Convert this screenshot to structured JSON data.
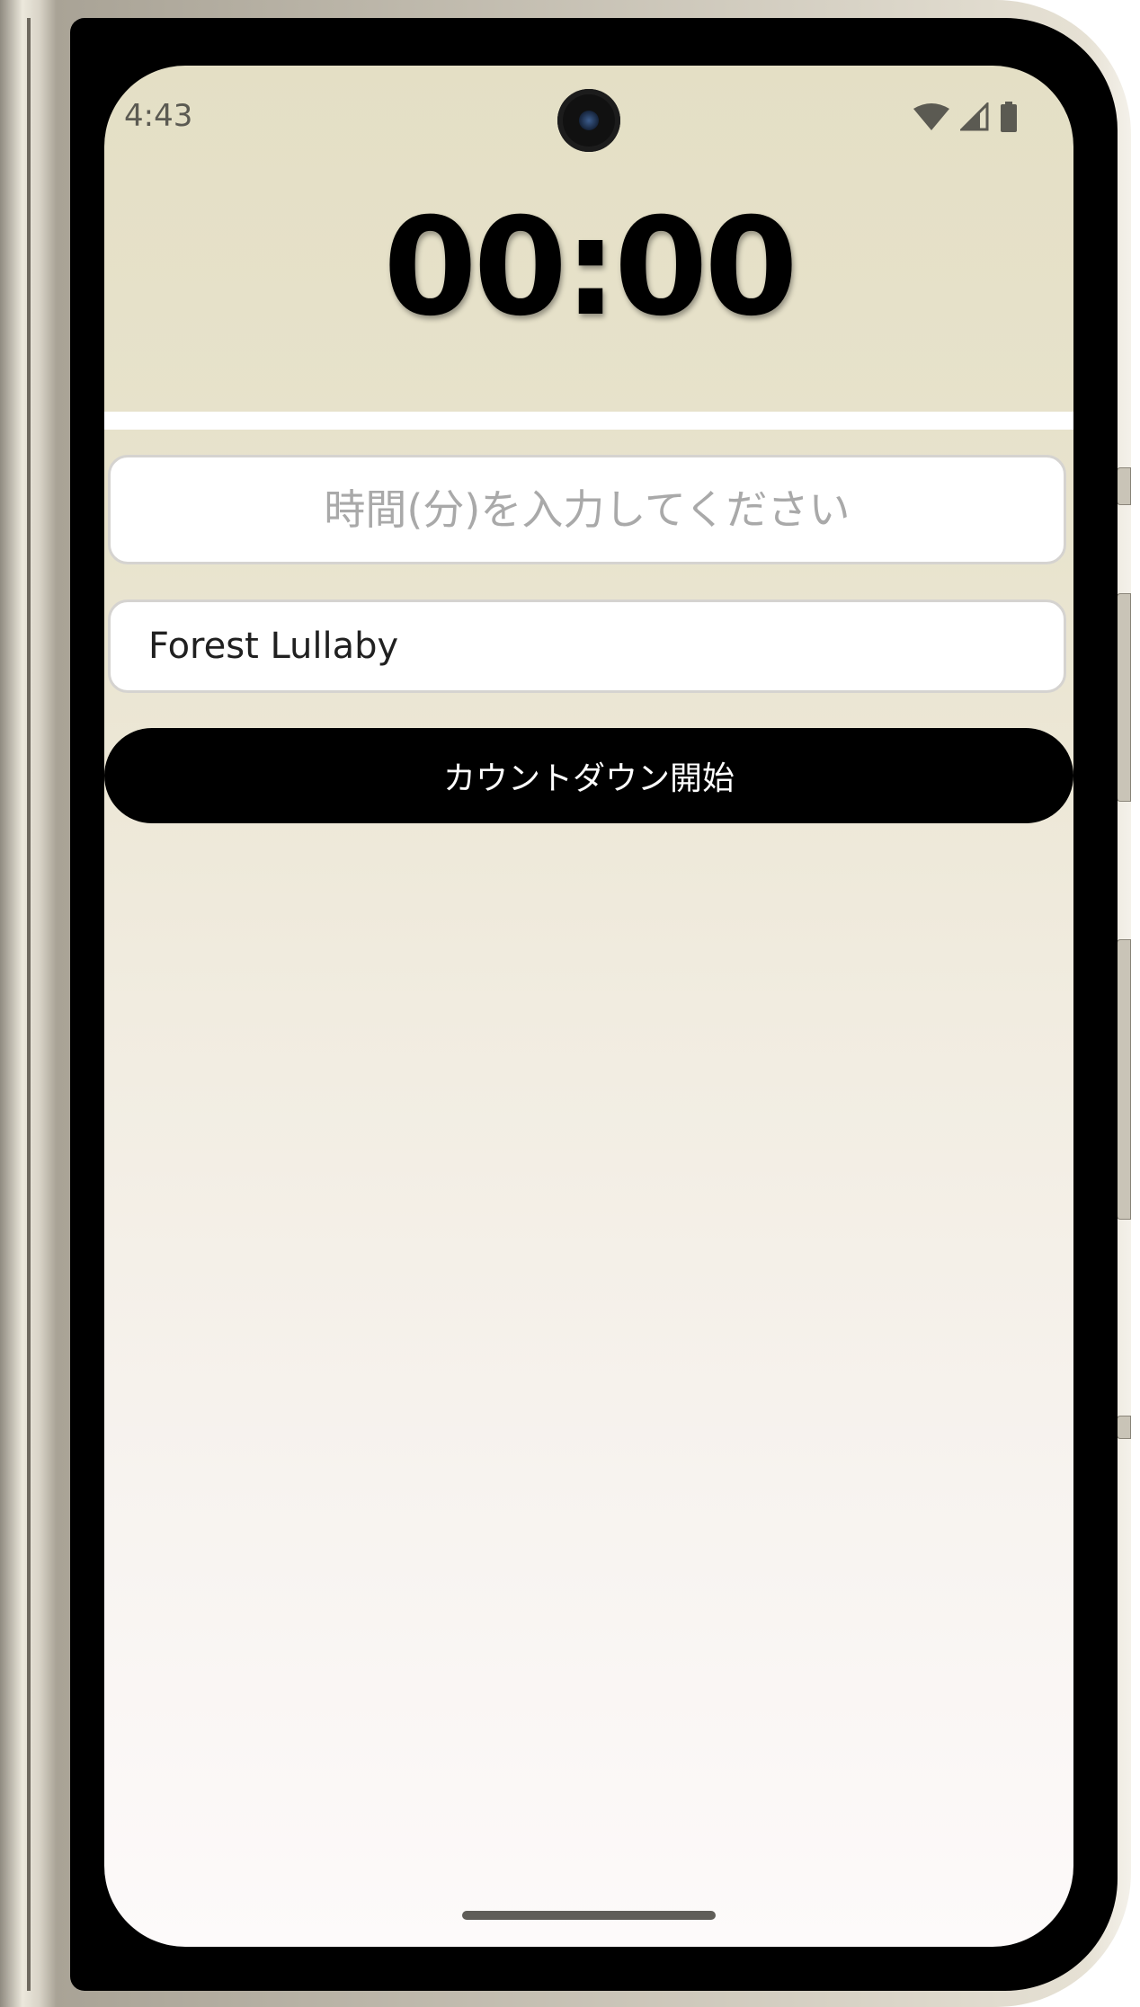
{
  "status_bar": {
    "time": "4:43",
    "icons": [
      "wifi-icon",
      "cell-signal-icon",
      "battery-icon"
    ]
  },
  "timer": {
    "display": "00:00"
  },
  "minutes_input": {
    "value": "",
    "placeholder": "時間(分)を入力してください"
  },
  "sound_select": {
    "selected": "Forest Lullaby"
  },
  "start_button": {
    "label": "カウントダウン開始"
  },
  "colors": {
    "background_top": "#e4dfc5",
    "background_bottom": "#fdfafa",
    "button": "#000000",
    "button_text": "#ffffff"
  }
}
